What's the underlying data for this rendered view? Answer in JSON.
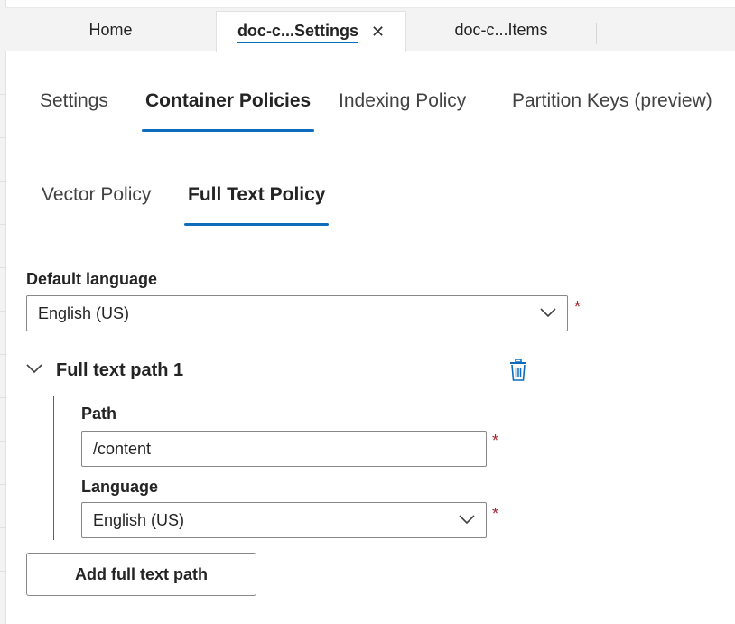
{
  "document_tabs": [
    {
      "label": "Home",
      "active": false
    },
    {
      "label": "doc-c...Settings",
      "active": true,
      "close_icon": "close-icon"
    },
    {
      "label": "doc-c...Items",
      "active": false
    }
  ],
  "settings_tabs": [
    {
      "label": "Settings",
      "active": false
    },
    {
      "label": "Container Policies",
      "active": true
    },
    {
      "label": "Indexing Policy",
      "active": false
    },
    {
      "label": "Partition Keys (preview)",
      "active": false
    }
  ],
  "policy_tabs": [
    {
      "label": "Vector Policy",
      "active": false
    },
    {
      "label": "Full Text Policy",
      "active": true
    }
  ],
  "default_language": {
    "label": "Default language",
    "value": "English (US)",
    "required_marker": "*"
  },
  "full_text_path": {
    "title": "Full text path 1",
    "path_label": "Path",
    "path_value": "/content",
    "path_required": "*",
    "language_label": "Language",
    "language_value": "English (US)",
    "language_required": "*",
    "delete_icon": "trash-icon",
    "expander_icon": "chevron-down-icon"
  },
  "add_button": {
    "label": "Add full text path"
  },
  "colors": {
    "accent": "#0f6cbd",
    "required": "#a4262c",
    "trash": "#0f6cbd"
  }
}
